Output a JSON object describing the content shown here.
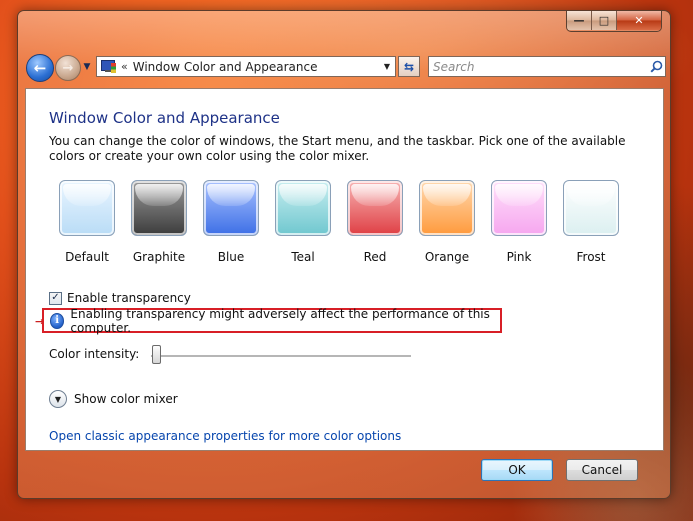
{
  "window": {
    "caption_buttons": {
      "minimize": "—",
      "maximize": "□",
      "close": "✕"
    },
    "address": {
      "prefix": "«",
      "path": "Window Color and Appearance"
    },
    "search": {
      "placeholder": "Search"
    }
  },
  "page": {
    "title": "Window Color and Appearance",
    "description": "You can change the color of windows, the Start menu, and the taskbar. Pick one of the available colors or create your own color using the color mixer.",
    "swatches": [
      {
        "label": "Default",
        "color_top": "#e9f5ff",
        "color_bottom": "#b9dcf6"
      },
      {
        "label": "Graphite",
        "color_top": "#9a9a9a",
        "color_bottom": "#3c3c3c"
      },
      {
        "label": "Blue",
        "color_top": "#a9c2ff",
        "color_bottom": "#3d6fe6"
      },
      {
        "label": "Teal",
        "color_top": "#c8eef0",
        "color_bottom": "#6fc7cf"
      },
      {
        "label": "Red",
        "color_top": "#f7b3b3",
        "color_bottom": "#df3f44"
      },
      {
        "label": "Orange",
        "color_top": "#ffd9b0",
        "color_bottom": "#ff9a3c"
      },
      {
        "label": "Pink",
        "color_top": "#ffe0fa",
        "color_bottom": "#f6a6ef"
      },
      {
        "label": "Frost",
        "color_top": "#ffffff",
        "color_bottom": "#dbeff0"
      }
    ],
    "transparency": {
      "label": "Enable transparency",
      "checked": true
    },
    "warning": {
      "arrow": "→",
      "text": "Enabling transparency might adversely affect the performance of this computer."
    },
    "intensity": {
      "label": "Color intensity:",
      "value_percent": 0
    },
    "mixer": {
      "label": "Show color mixer"
    },
    "classic_link": "Open classic appearance properties for more color options"
  },
  "buttons": {
    "ok": "OK",
    "cancel": "Cancel"
  },
  "colors": {
    "accent_red": "#d81f26",
    "title_blue": "#1e3287",
    "link_blue": "#0645ad"
  }
}
